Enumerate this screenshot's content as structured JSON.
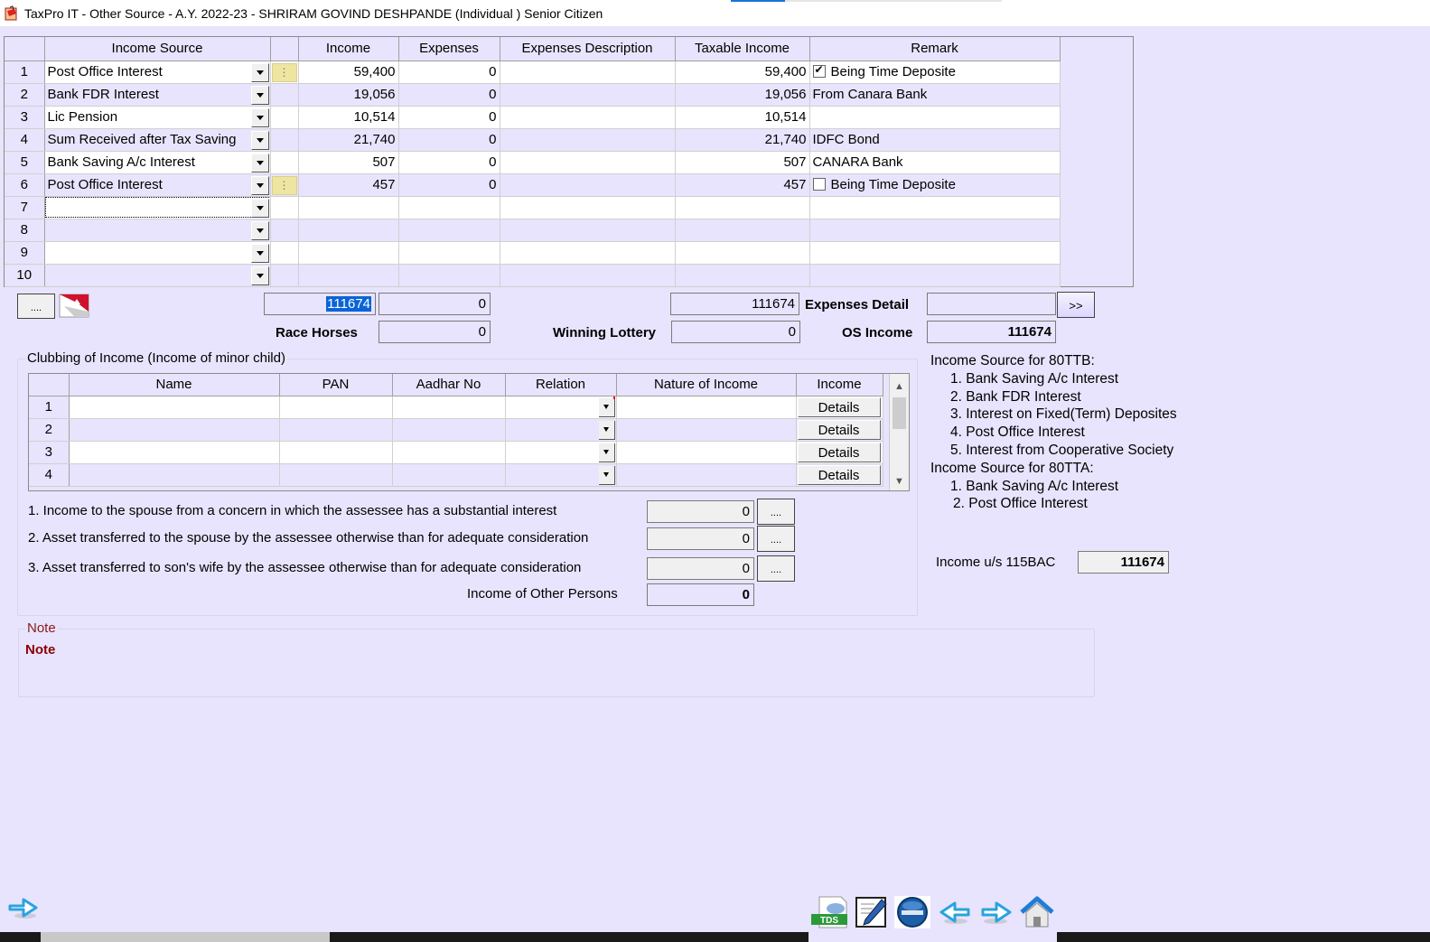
{
  "window": {
    "title": "TaxPro IT - Other Source - A.Y. 2022-23 - SHRIRAM GOVIND DESHPANDE (Individual ) Senior Citizen",
    "progress_percent": 20
  },
  "income_grid": {
    "columns": [
      "",
      "Income Source",
      "",
      "Income",
      "Expenses",
      "Expenses Description",
      "Taxable Income",
      "Remark"
    ],
    "rows": [
      {
        "no": "1",
        "source": "Post Office Interest",
        "has_detail_btn": true,
        "income": "59,400",
        "expenses": "0",
        "exp_desc": "",
        "taxable": "59,400",
        "remark": "Being Time Deposite",
        "remark_checkbox": true,
        "remark_checked": true
      },
      {
        "no": "2",
        "source": "Bank FDR Interest",
        "has_detail_btn": false,
        "income": "19,056",
        "expenses": "0",
        "exp_desc": "",
        "taxable": "19,056",
        "remark": "From Canara Bank",
        "remark_checkbox": false,
        "remark_checked": false
      },
      {
        "no": "3",
        "source": "Lic Pension",
        "has_detail_btn": false,
        "income": "10,514",
        "expenses": "0",
        "exp_desc": "",
        "taxable": "10,514",
        "remark": "",
        "remark_checkbox": false,
        "remark_checked": false
      },
      {
        "no": "4",
        "source": "Sum Received after Tax Saving",
        "has_detail_btn": false,
        "income": "21,740",
        "expenses": "0",
        "exp_desc": "",
        "taxable": "21,740",
        "remark": "IDFC Bond",
        "remark_checkbox": false,
        "remark_checked": false
      },
      {
        "no": "5",
        "source": "Bank Saving A/c Interest",
        "has_detail_btn": false,
        "income": "507",
        "expenses": "0",
        "exp_desc": "",
        "taxable": "507",
        "remark": "CANARA Bank",
        "remark_checkbox": false,
        "remark_checked": false
      },
      {
        "no": "6",
        "source": "Post Office Interest",
        "has_detail_btn": true,
        "income": "457",
        "expenses": "0",
        "exp_desc": "",
        "taxable": "457",
        "remark": "Being Time Deposite",
        "remark_checkbox": true,
        "remark_checked": false
      },
      {
        "no": "7",
        "source": "",
        "has_detail_btn": false,
        "income": "",
        "expenses": "",
        "exp_desc": "",
        "taxable": "",
        "remark": "",
        "remark_checkbox": false,
        "remark_checked": false
      },
      {
        "no": "8",
        "source": "",
        "has_detail_btn": false,
        "income": "",
        "expenses": "",
        "exp_desc": "",
        "taxable": "",
        "remark": "",
        "remark_checkbox": false,
        "remark_checked": false
      },
      {
        "no": "9",
        "source": "",
        "has_detail_btn": false,
        "income": "",
        "expenses": "",
        "exp_desc": "",
        "taxable": "",
        "remark": "",
        "remark_checkbox": false,
        "remark_checked": false
      },
      {
        "no": "10",
        "source": "",
        "has_detail_btn": false,
        "income": "",
        "expenses": "",
        "exp_desc": "",
        "taxable": "",
        "remark": "",
        "remark_checkbox": false,
        "remark_checked": false
      }
    ],
    "detail_btn_label": "⋮"
  },
  "totals": {
    "ellipsis_button": "....",
    "total_income": "111674",
    "total_expenses": "0",
    "total_taxable": "111674",
    "expenses_detail_label": "Expenses Detail",
    "expenses_detail_value": "",
    "go_button": ">>",
    "race_horses_label": "Race Horses",
    "race_horses_value": "0",
    "winning_lottery_label": "Winning Lottery",
    "winning_lottery_value": "0",
    "os_income_label": "OS Income",
    "os_income_value": "111674"
  },
  "clubbing": {
    "title": "Clubbing of Income (Income of minor child)",
    "columns": [
      "",
      "Name",
      "PAN",
      "Aadhar No",
      "Relation",
      "Nature of Income",
      "Income"
    ],
    "rows": [
      {
        "no": "1",
        "name": "",
        "pan": "",
        "aadhar": "",
        "relation": "",
        "nature": "",
        "income_btn": "Details"
      },
      {
        "no": "2",
        "name": "",
        "pan": "",
        "aadhar": "",
        "relation": "",
        "nature": "",
        "income_btn": "Details"
      },
      {
        "no": "3",
        "name": "",
        "pan": "",
        "aadhar": "",
        "relation": "",
        "nature": "",
        "income_btn": "Details"
      },
      {
        "no": "4",
        "name": "",
        "pan": "",
        "aadhar": "",
        "relation": "",
        "nature": "",
        "income_btn": "Details"
      }
    ],
    "items": [
      {
        "label": "1. Income to the spouse from a concern in which the assessee has a substantial interest",
        "value": "0",
        "button": "...."
      },
      {
        "label": "2. Asset transferred to the spouse by the assessee otherwise than for adequate consideration",
        "value": "0",
        "button": "...."
      },
      {
        "label": "3. Asset transferred to son's wife by the assessee otherwise than for adequate consideration",
        "value": "0",
        "button": "...."
      }
    ],
    "other_persons_label": "Income of Other Persons",
    "other_persons_value": "0"
  },
  "info_panel": {
    "heading_80ttb": "Income Source for 80TTB:",
    "list_80ttb": [
      "1. Bank Saving A/c Interest",
      "2. Bank FDR Interest",
      "3. Interest on Fixed(Term) Deposites",
      "4. Post Office Interest",
      "5. Interest from Cooperative Society"
    ],
    "heading_80tta": "Income Source for 80TTA:",
    "list_80tta": [
      "1. Bank Saving A/c Interest",
      "2. Post Office Interest"
    ],
    "income_115bac_label": "Income u/s 115BAC",
    "income_115bac_value": "111674"
  },
  "note": {
    "group_title": "Note",
    "text": "Note"
  },
  "toolbar": {
    "icons": [
      "tds-icon",
      "edit-document-icon",
      "efiling-icon",
      "back-arrow-icon",
      "forward-arrow-icon",
      "home-icon"
    ],
    "tds_label": "TDS"
  },
  "colors": {
    "background": "#e8e4fd",
    "accent_blue": "#1a73d8",
    "note_red": "#8b0000",
    "yellow_button": "#eee6a0"
  }
}
